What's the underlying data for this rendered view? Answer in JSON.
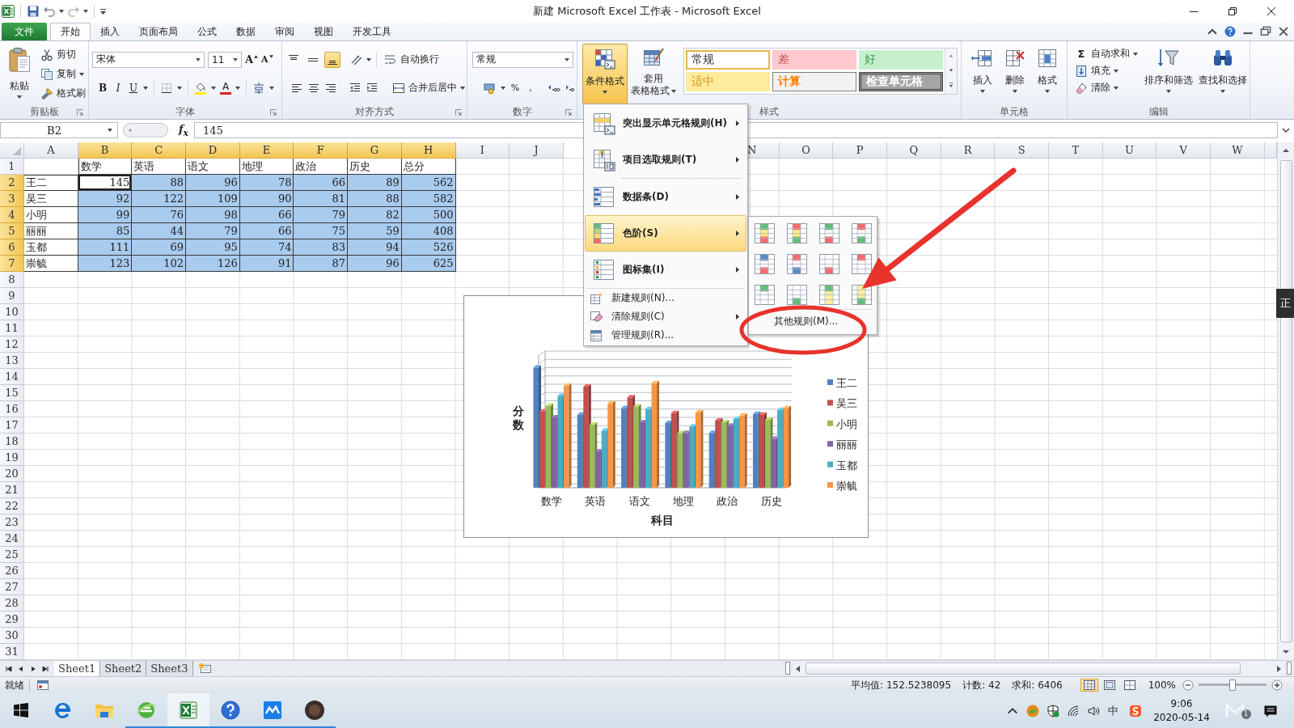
{
  "title_bar": {
    "title": "新建 Microsoft Excel 工作表 - Microsoft Excel"
  },
  "tabs": [
    {
      "label": "文件",
      "kind": "file",
      "selected": false
    },
    {
      "label": "开始",
      "kind": "tab",
      "selected": true
    },
    {
      "label": "插入",
      "kind": "tab",
      "selected": false
    },
    {
      "label": "页面布局",
      "kind": "tab",
      "selected": false
    },
    {
      "label": "公式",
      "kind": "tab",
      "selected": false
    },
    {
      "label": "数据",
      "kind": "tab",
      "selected": false
    },
    {
      "label": "审阅",
      "kind": "tab",
      "selected": false
    },
    {
      "label": "视图",
      "kind": "tab",
      "selected": false
    },
    {
      "label": "开发工具",
      "kind": "tab",
      "selected": false
    }
  ],
  "ribbon": {
    "clipboard": {
      "label": "剪贴板",
      "paste": "粘贴",
      "commands": [
        {
          "kind": "cut",
          "label": "剪切",
          "dropdown": false
        },
        {
          "kind": "copy",
          "label": "复制",
          "dropdown": true
        },
        {
          "kind": "painter",
          "label": "格式刷",
          "dropdown": false
        }
      ]
    },
    "font": {
      "label": "字体",
      "family": "宋体",
      "size": "11",
      "grow": "A",
      "shrink": "A",
      "bold": "B",
      "italic": "I",
      "underline": "U",
      "font_color": "A"
    },
    "alignment": {
      "label": "对齐方式",
      "vertical": [
        {
          "kind": "top",
          "selected": false
        },
        {
          "kind": "middle",
          "selected": false
        },
        {
          "kind": "bottom",
          "selected": true
        }
      ],
      "wrap": "自动换行",
      "merge": "合并后居中"
    },
    "number": {
      "label": "数字",
      "format": "常规",
      "percent": "%",
      "comma": ","
    },
    "styles": {
      "label": "样式",
      "conditional": {
        "label": "条件格式",
        "expanded": true
      },
      "table_format": [
        "套用",
        "表格格式"
      ],
      "cell_styles": [
        {
          "kind": "normal",
          "label": "常规",
          "selected": true
        },
        {
          "kind": "bad",
          "label": "差",
          "selected": false
        },
        {
          "kind": "good",
          "label": "好",
          "selected": false
        },
        {
          "kind": "neutral",
          "label": "适中",
          "selected": false
        },
        {
          "kind": "calculation",
          "label": "计算",
          "selected": false
        },
        {
          "kind": "check",
          "label": "检查单元格",
          "selected": false
        }
      ]
    },
    "cells": {
      "label": "单元格",
      "commands": [
        {
          "kind": "insert",
          "label": "插入"
        },
        {
          "kind": "delete",
          "label": "删除"
        },
        {
          "kind": "format",
          "label": "格式"
        }
      ]
    },
    "editing": {
      "label": "编辑",
      "commands": [
        {
          "kind": "sum",
          "symbol": "Σ",
          "label": "自动求和"
        },
        {
          "kind": "fill",
          "label": "填充"
        },
        {
          "kind": "clear",
          "label": "清除"
        }
      ],
      "large": [
        {
          "kind": "sort",
          "label": "排序和筛选"
        },
        {
          "kind": "find",
          "label": "查找和选择"
        }
      ]
    }
  },
  "conditional_menu": {
    "items": [
      {
        "kind": "highlight-rules",
        "label": "突出显示单元格规则(H)",
        "submenu": true,
        "selected": false
      },
      {
        "kind": "top-bottom-rules",
        "label": "项目选取规则(T)",
        "submenu": true,
        "selected": false
      },
      {
        "kind": "data-bars",
        "label": "数据条(D)",
        "submenu": true,
        "selected": false
      },
      {
        "kind": "color-scales",
        "label": "色阶(S)",
        "submenu": true,
        "selected": true
      },
      {
        "kind": "icon-sets",
        "label": "图标集(I)",
        "submenu": true,
        "selected": false
      },
      {
        "kind": "new-rule",
        "label": "新建规则(N)...",
        "submenu": false,
        "selected": false
      },
      {
        "kind": "clear-rules",
        "label": "清除规则(C)",
        "submenu": true,
        "selected": false
      },
      {
        "kind": "manage-rules",
        "label": "管理规则(R)...",
        "submenu": false,
        "selected": false
      }
    ],
    "color_scales": {
      "more": "其他规则(M)..."
    }
  },
  "formula_bar": {
    "name_box": "B2",
    "function_button": "f$_{x}$",
    "content": "145"
  },
  "sheet": {
    "columns_left": [
      {
        "label": "A",
        "selected": false
      },
      {
        "label": "B",
        "selected": true
      },
      {
        "label": "C",
        "selected": true
      },
      {
        "label": "D",
        "selected": true
      },
      {
        "label": "E",
        "selected": true
      },
      {
        "label": "F",
        "selected": true
      },
      {
        "label": "G",
        "selected": true
      },
      {
        "label": "H",
        "selected": true
      },
      {
        "label": "I",
        "selected": false
      },
      {
        "label": "J",
        "selected": false
      }
    ],
    "columns_right": [
      {
        "label": "N",
        "selected": false
      },
      {
        "label": "O",
        "selected": false
      },
      {
        "label": "P",
        "selected": false
      },
      {
        "label": "Q",
        "selected": false
      },
      {
        "label": "R",
        "selected": false
      },
      {
        "label": "S",
        "selected": false
      },
      {
        "label": "T",
        "selected": false
      },
      {
        "label": "U",
        "selected": false
      },
      {
        "label": "V",
        "selected": false
      },
      {
        "label": "W",
        "selected": false
      }
    ],
    "rows": [
      {
        "label": "1",
        "selected": false
      },
      {
        "label": "2",
        "selected": true
      },
      {
        "label": "3",
        "selected": true
      },
      {
        "label": "4",
        "selected": true
      },
      {
        "label": "5",
        "selected": true
      },
      {
        "label": "6",
        "selected": true
      },
      {
        "label": "7",
        "selected": true
      },
      {
        "label": "8",
        "selected": false
      },
      {
        "label": "9",
        "selected": false
      },
      {
        "label": "10",
        "selected": false
      },
      {
        "label": "11",
        "selected": false
      },
      {
        "label": "12",
        "selected": false
      },
      {
        "label": "13",
        "selected": false
      },
      {
        "label": "14",
        "selected": false
      },
      {
        "label": "15",
        "selected": false
      },
      {
        "label": "16",
        "selected": false
      },
      {
        "label": "17",
        "selected": false
      },
      {
        "label": "18",
        "selected": false
      },
      {
        "label": "19",
        "selected": false
      },
      {
        "label": "20",
        "selected": false
      },
      {
        "label": "21",
        "selected": false
      },
      {
        "label": "22",
        "selected": false
      },
      {
        "label": "23",
        "selected": false
      },
      {
        "label": "24",
        "selected": false
      },
      {
        "label": "25",
        "selected": false
      },
      {
        "label": "26",
        "selected": false
      },
      {
        "label": "27",
        "selected": false
      },
      {
        "label": "28",
        "selected": false
      },
      {
        "label": "29",
        "selected": false
      },
      {
        "label": "30",
        "selected": false
      },
      {
        "label": "31",
        "selected": false
      }
    ],
    "table": {
      "headers": [
        "数学",
        "英语",
        "语文",
        "地理",
        "政治",
        "历史",
        "总分"
      ],
      "rows": [
        {
          "name": "王二",
          "cells": [
            {
              "value": "145",
              "selected": true,
              "active": true
            },
            {
              "value": "88",
              "selected": true,
              "active": false
            },
            {
              "value": "96",
              "selected": true,
              "active": false
            },
            {
              "value": "78",
              "selected": true,
              "active": false
            },
            {
              "value": "66",
              "selected": true,
              "active": false
            },
            {
              "value": "89",
              "selected": true,
              "active": false
            },
            {
              "value": "562",
              "selected": true,
              "active": false
            }
          ]
        },
        {
          "name": "吴三",
          "cells": [
            {
              "value": "92",
              "selected": true,
              "active": false
            },
            {
              "value": "122",
              "selected": true,
              "active": false
            },
            {
              "value": "109",
              "selected": true,
              "active": false
            },
            {
              "value": "90",
              "selected": true,
              "active": false
            },
            {
              "value": "81",
              "selected": true,
              "active": false
            },
            {
              "value": "88",
              "selected": true,
              "active": false
            },
            {
              "value": "582",
              "selected": true,
              "active": false
            }
          ]
        },
        {
          "name": "小明",
          "cells": [
            {
              "value": "99",
              "selected": true,
              "active": false
            },
            {
              "value": "76",
              "selected": true,
              "active": false
            },
            {
              "value": "98",
              "selected": true,
              "active": false
            },
            {
              "value": "66",
              "selected": true,
              "active": false
            },
            {
              "value": "79",
              "selected": true,
              "active": false
            },
            {
              "value": "82",
              "selected": true,
              "active": false
            },
            {
              "value": "500",
              "selected": true,
              "active": false
            }
          ]
        },
        {
          "name": "丽丽",
          "cells": [
            {
              "value": "85",
              "selected": true,
              "active": false
            },
            {
              "value": "44",
              "selected": true,
              "active": false
            },
            {
              "value": "79",
              "selected": true,
              "active": false
            },
            {
              "value": "66",
              "selected": true,
              "active": false
            },
            {
              "value": "75",
              "selected": true,
              "active": false
            },
            {
              "value": "59",
              "selected": true,
              "active": false
            },
            {
              "value": "408",
              "selected": true,
              "active": false
            }
          ]
        },
        {
          "name": "玉都",
          "cells": [
            {
              "value": "111",
              "selected": true,
              "active": false
            },
            {
              "value": "69",
              "selected": true,
              "active": false
            },
            {
              "value": "95",
              "selected": true,
              "active": false
            },
            {
              "value": "74",
              "selected": true,
              "active": false
            },
            {
              "value": "83",
              "selected": true,
              "active": false
            },
            {
              "value": "94",
              "selected": true,
              "active": false
            },
            {
              "value": "526",
              "selected": true,
              "active": false
            }
          ]
        },
        {
          "name": "崇毓",
          "cells": [
            {
              "value": "123",
              "selected": true,
              "active": false
            },
            {
              "value": "102",
              "selected": true,
              "active": false
            },
            {
              "value": "126",
              "selected": true,
              "active": false
            },
            {
              "value": "91",
              "selected": true,
              "active": false
            },
            {
              "value": "87",
              "selected": true,
              "active": false
            },
            {
              "value": "96",
              "selected": true,
              "active": false
            },
            {
              "value": "625",
              "selected": true,
              "active": false
            }
          ]
        }
      ]
    }
  },
  "chart": {
    "y_title": "分数",
    "x_title": "科目",
    "categories": [
      "数学",
      "英语",
      "语文",
      "地理",
      "政治",
      "历史"
    ],
    "legend": [
      {
        "label": "王二",
        "color": "#4f81bd"
      },
      {
        "label": "吴三",
        "color": "#c0504d"
      },
      {
        "label": "小明",
        "color": "#9bbb59"
      },
      {
        "label": "丽丽",
        "color": "#8064a2"
      },
      {
        "label": "玉都",
        "color": "#4bacc6"
      },
      {
        "label": "崇毓",
        "color": "#f79646"
      }
    ]
  },
  "sheet_tabs": [
    {
      "label": "Sheet1",
      "selected": true
    },
    {
      "label": "Sheet2",
      "selected": false
    },
    {
      "label": "Sheet3",
      "selected": false
    }
  ],
  "status_bar": {
    "mode": "就绪",
    "stats": [
      "平均值: 152.5238095",
      "计数: 42",
      "求和: 6406"
    ],
    "views": [
      {
        "kind": "normal",
        "selected": true
      },
      {
        "kind": "page-layout",
        "selected": false
      },
      {
        "kind": "page-break",
        "selected": false
      }
    ],
    "zoom": {
      "label": "100%",
      "level": 0.5
    }
  },
  "side_tab": "正",
  "taskbar": {
    "apps": [
      {
        "kind": "edge",
        "running": false,
        "selected": false
      },
      {
        "kind": "explorer",
        "running": false,
        "selected": false
      },
      {
        "kind": "browser",
        "running": true,
        "selected": false
      },
      {
        "kind": "excel",
        "running": true,
        "selected": true
      },
      {
        "kind": "help",
        "running": true,
        "selected": false
      },
      {
        "kind": "chat",
        "running": true,
        "selected": false
      },
      {
        "kind": "media",
        "running": true,
        "selected": false
      }
    ],
    "ime": "中",
    "time": "9:06",
    "date": "2020-05-14",
    "badge": "1"
  }
}
